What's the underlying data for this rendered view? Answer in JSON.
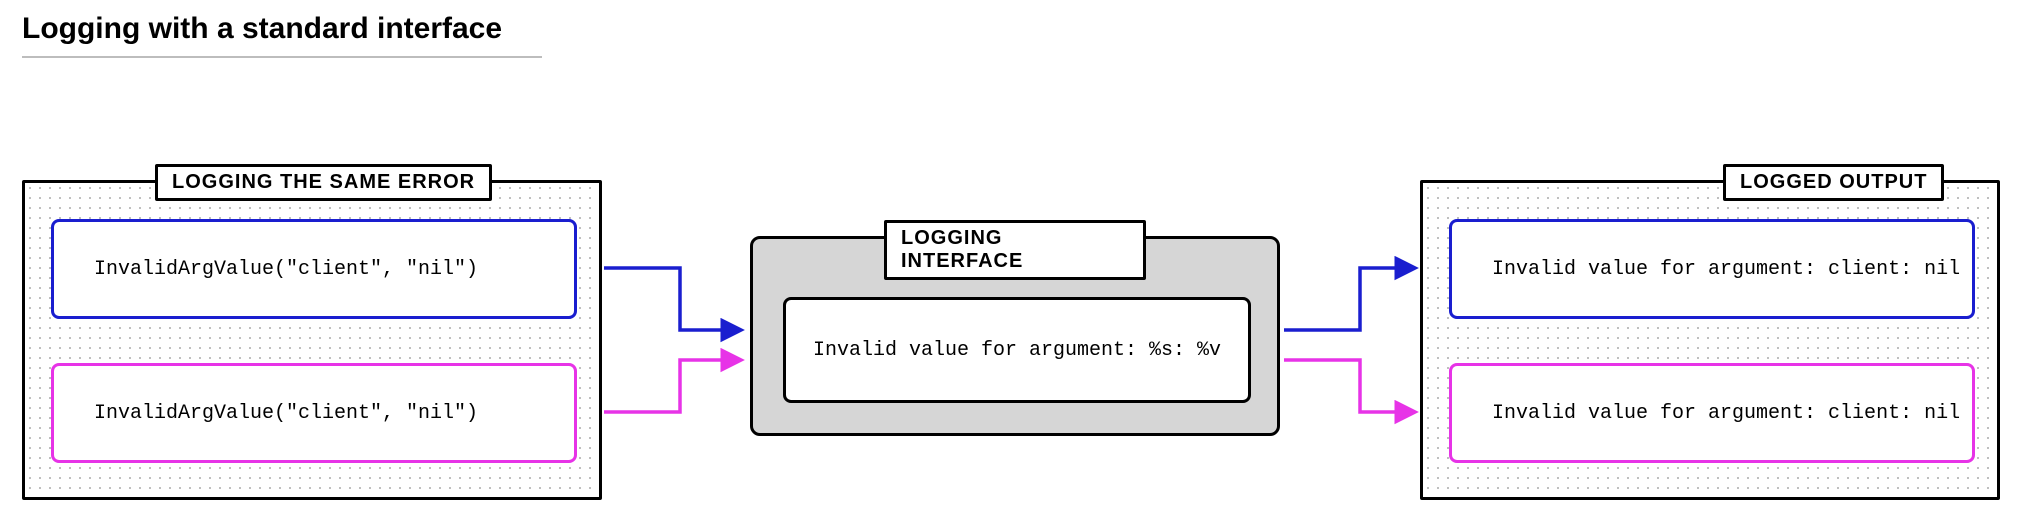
{
  "title": "Logging with a standard interface",
  "panels": {
    "left": {
      "label": "LOGGING THE SAME ERROR"
    },
    "mid": {
      "label": "LOGGING INTERFACE"
    },
    "right": {
      "label": "LOGGED OUTPUT"
    }
  },
  "boxes": {
    "input_blue": "InvalidArgValue(\"client\", \"nil\")",
    "input_magenta": "InvalidArgValue(\"client\", \"nil\")",
    "interface": "Invalid value for argument: %s: %v",
    "output_blue": "Invalid value for argument: client: nil",
    "output_magenta": "Invalid value for argument: client: nil"
  },
  "colors": {
    "blue": "#1a1ecf",
    "magenta": "#e733e7",
    "black": "#000000"
  }
}
